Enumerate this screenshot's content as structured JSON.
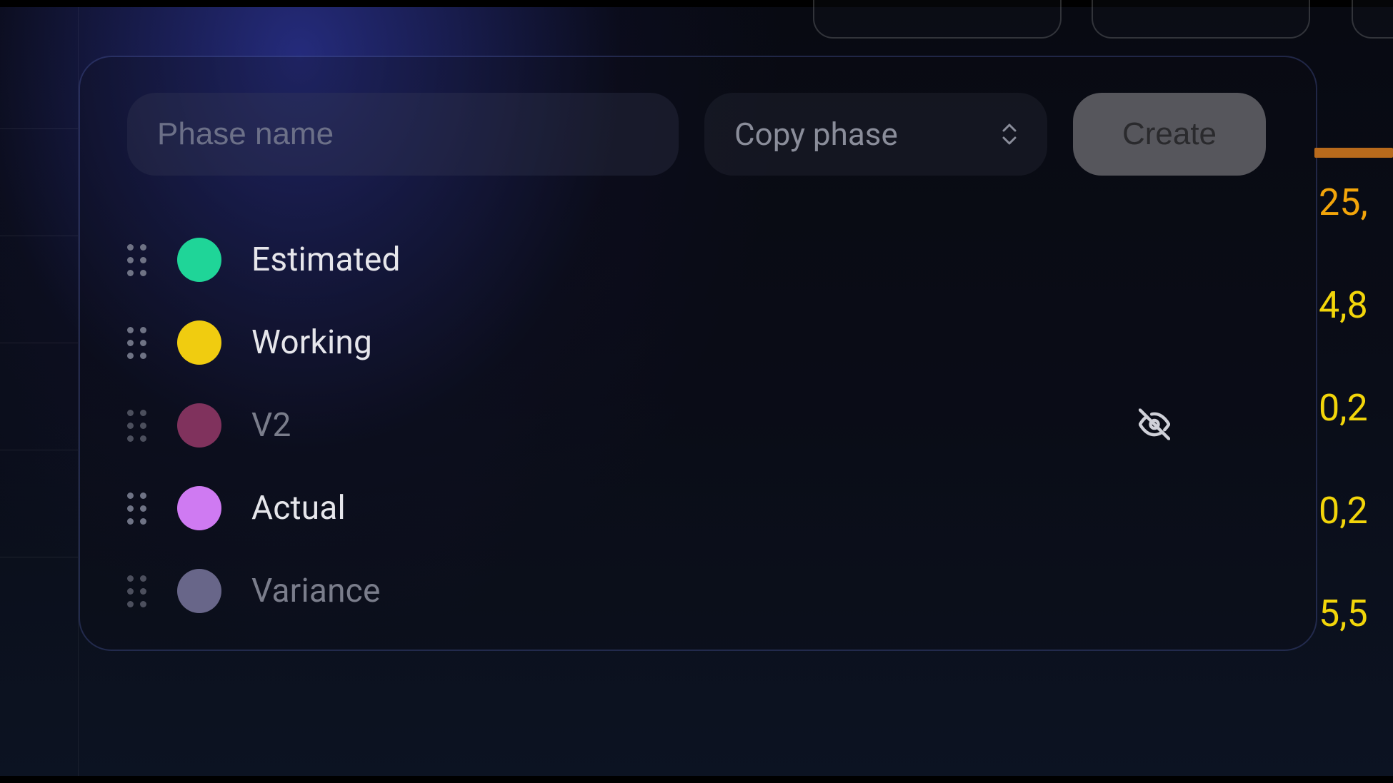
{
  "controls": {
    "phase_name_placeholder": "Phase name",
    "copy_phase_label": "Copy phase",
    "create_label": "Create"
  },
  "phases": [
    {
      "label": "Estimated",
      "color": "#1fd598",
      "dim": false,
      "hidden": false
    },
    {
      "label": "Working",
      "color": "#f0cc10",
      "dim": false,
      "hidden": false
    },
    {
      "label": "V2",
      "color": "#c53a86",
      "dim": true,
      "hidden": true
    },
    {
      "label": "Actual",
      "color": "#cf7af2",
      "dim": false,
      "hidden": false
    },
    {
      "label": "Variance",
      "color": "#8a86c5",
      "dim": true,
      "hidden": false
    }
  ],
  "side_values": [
    {
      "text": "25,",
      "color_class": "color-orange"
    },
    {
      "text": "4,8",
      "color_class": "color-yellow"
    },
    {
      "text": "0,2",
      "color_class": "color-yellow"
    },
    {
      "text": "0,2",
      "color_class": "color-yellow"
    },
    {
      "text": "5,5",
      "color_class": "color-yellow"
    }
  ]
}
